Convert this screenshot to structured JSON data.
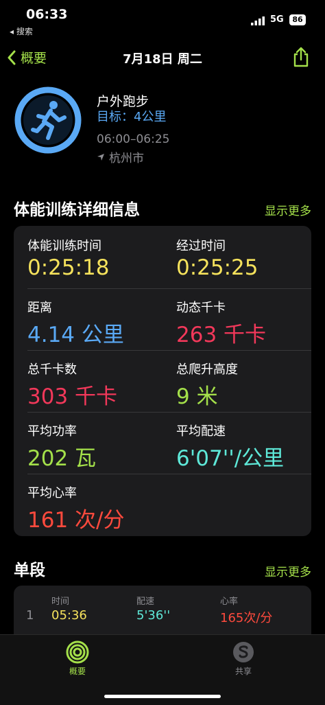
{
  "status_bar": {
    "time": "06:33",
    "back_app": "◂ 搜索",
    "network": "5G",
    "battery": "86"
  },
  "nav": {
    "back_label": "概要",
    "title": "7月18日 周二"
  },
  "workout": {
    "name": "户外跑步",
    "goal": "目标：4公里",
    "time_range": "06:00–06:25",
    "location": "杭州市"
  },
  "details": {
    "title": "体能训练详细信息",
    "show_more": "显示更多",
    "metrics": [
      {
        "label": "体能训练时间",
        "value": "0:25:18",
        "color": "#f5e25c"
      },
      {
        "label": "经过时间",
        "value": "0:25:25",
        "color": "#f5e25c"
      },
      {
        "label": "距离",
        "value": "4.14 公里",
        "color": "#5aa9f5"
      },
      {
        "label": "动态千卡",
        "value": "263 千卡",
        "color": "#f2385a"
      },
      {
        "label": "总千卡数",
        "value": "303 千卡",
        "color": "#f2385a"
      },
      {
        "label": "总爬升高度",
        "value": "9 米",
        "color": "#a4e04a"
      },
      {
        "label": "平均功率",
        "value": "202 瓦",
        "color": "#a4e04a"
      },
      {
        "label": "平均配速",
        "value": "6'07''/公里",
        "color": "#5ee8d8"
      },
      {
        "label": "平均心率",
        "value": "161 次/分",
        "color": "#ff4a3d"
      }
    ]
  },
  "splits": {
    "title": "单段",
    "show_more": "显示更多",
    "headers": {
      "time": "时间",
      "pace": "配速",
      "heart_rate": "心率"
    },
    "rows": [
      {
        "index": "1",
        "time": "05:36",
        "pace": "5'36''",
        "heart_rate": "165次/分"
      }
    ]
  },
  "tabbar": {
    "summary": "概要",
    "sharing": "共享"
  },
  "colors": {
    "accent": "#a4e04a",
    "ring": "#5aa9f5"
  }
}
